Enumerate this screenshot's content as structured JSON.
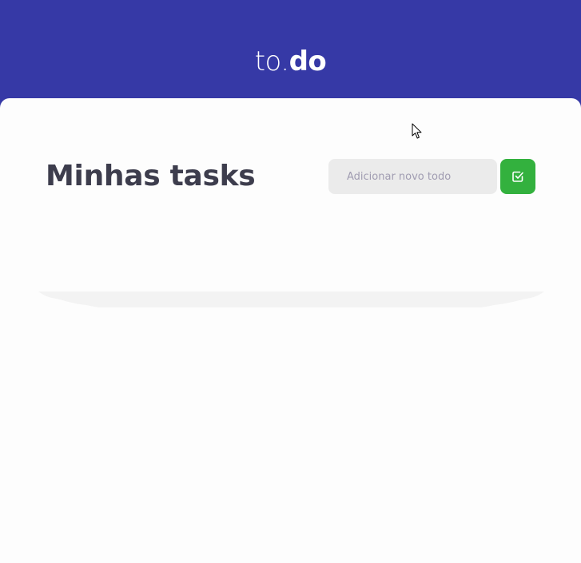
{
  "header": {
    "logo_light": "to.",
    "logo_bold": "do",
    "background_color": "#3639a6"
  },
  "main": {
    "title": "Minhas tasks",
    "new_todo": {
      "placeholder": "Adicionar novo todo",
      "value": ""
    },
    "add_button": {
      "icon": "check-square-icon",
      "color": "#33b13e"
    },
    "tasks": []
  },
  "cursor": {
    "icon": "mouse-pointer-icon"
  }
}
